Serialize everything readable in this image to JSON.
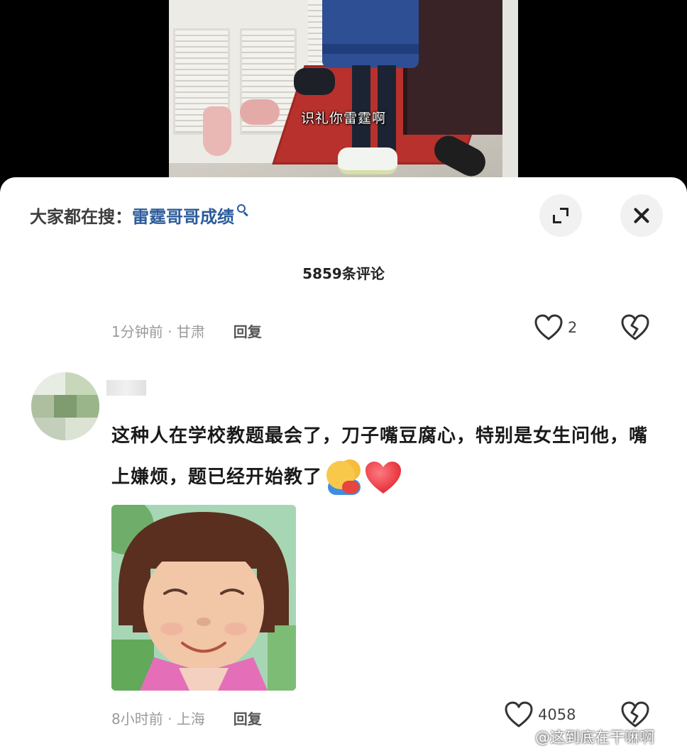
{
  "video": {
    "subtitle": "识礼你雷霆啊"
  },
  "search_bar": {
    "prefix": "大家都在搜：",
    "term": "雷霆哥哥成绩"
  },
  "header": {
    "comment_count": "5859条评论"
  },
  "comments": [
    {
      "meta": "1分钟前 · 甘肃",
      "reply_label": "回复",
      "likes": "2"
    },
    {
      "text": "这种人在学校教题最会了，刀子嘴豆腐心，特别是女生问他，嘴上嫌烦，题已经开始教了",
      "emojis": [
        "hug-emoji",
        "red-heart-emoji"
      ],
      "meta": "8小时前 · 上海",
      "reply_label": "回复",
      "likes": "4058"
    }
  ],
  "watermark": {
    "text": "@这到底在干嘛啊"
  },
  "colors": {
    "search_term": "#2a5a9a",
    "heart_emoji": "#ee3b44",
    "meta_text": "#9a9a9a"
  }
}
